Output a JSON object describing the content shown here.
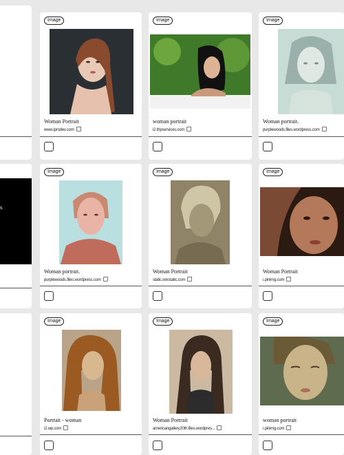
{
  "badge_label": "Image",
  "cards": [
    {
      "title": "Woman Portrait",
      "source": "www.iprodev.com"
    },
    {
      "title": "woman portrait",
      "source": "i2.thpservices.com"
    },
    {
      "title": "Woman portrait.",
      "source": "purplewoods.files.wordpress.com"
    },
    {
      "title": "Woman portrait.",
      "source": "purplewoods.files.wordpress.com"
    },
    {
      "title": "Woman Portrait",
      "source": "static.wixstatic.com"
    },
    {
      "title": "Woman Portrait",
      "source": "i.pinimg.com"
    },
    {
      "title": "Portrait - woman",
      "source": "i2.wp.com"
    },
    {
      "title": "Woman Portrait",
      "source": "americangallery20th.files.wordpres..."
    },
    {
      "title": "woman portrait",
      "source": "i.pinimg.com"
    }
  ],
  "left_panel_text": "s",
  "colors": {
    "background": "#e8e8e8",
    "card": "#ffffff",
    "text": "#111111"
  }
}
